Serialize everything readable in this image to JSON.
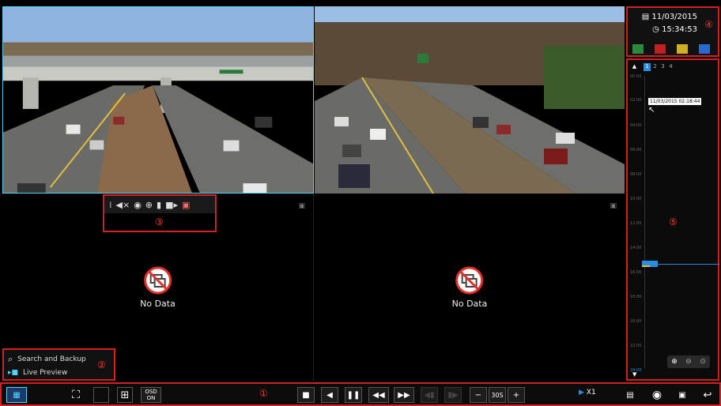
{
  "cameras": [
    {
      "id": "cam1",
      "state": "live"
    },
    {
      "id": "cam2",
      "state": "live"
    },
    {
      "id": "cam3",
      "state": "no-data",
      "label": "No Data"
    },
    {
      "id": "cam4",
      "state": "no-data",
      "label": "No Data"
    }
  ],
  "markers": {
    "m1": "①",
    "m2": "②",
    "m3": "③",
    "m4": "④",
    "m5": "⑤"
  },
  "context_menu": {
    "items": [
      {
        "label": "Search and Backup",
        "icon": "search-icon"
      },
      {
        "label": "Live Preview",
        "icon": "camera-icon"
      }
    ]
  },
  "datetime": {
    "date": "11/03/2015",
    "time": "15:34:53"
  },
  "timeline": {
    "channels": [
      "1",
      "2",
      "3",
      "4"
    ],
    "tooltip": "11/03/2015 02:18:44",
    "ticks": [
      "00:00",
      "02:00",
      "04:00",
      "06:00",
      "08:00",
      "10:00",
      "12:00",
      "14:00",
      "16:00",
      "18:00",
      "20:00",
      "22:00",
      "24:00"
    ]
  },
  "bottombar": {
    "osd_label": "OSD",
    "osd_value": "ON",
    "interval": "30S",
    "speed": "X1"
  },
  "colors": {
    "accent": "#4fd6ff",
    "highlight_border": "#d32121",
    "record_bar": "#2a8de0",
    "event_bar": "#f0c020"
  }
}
